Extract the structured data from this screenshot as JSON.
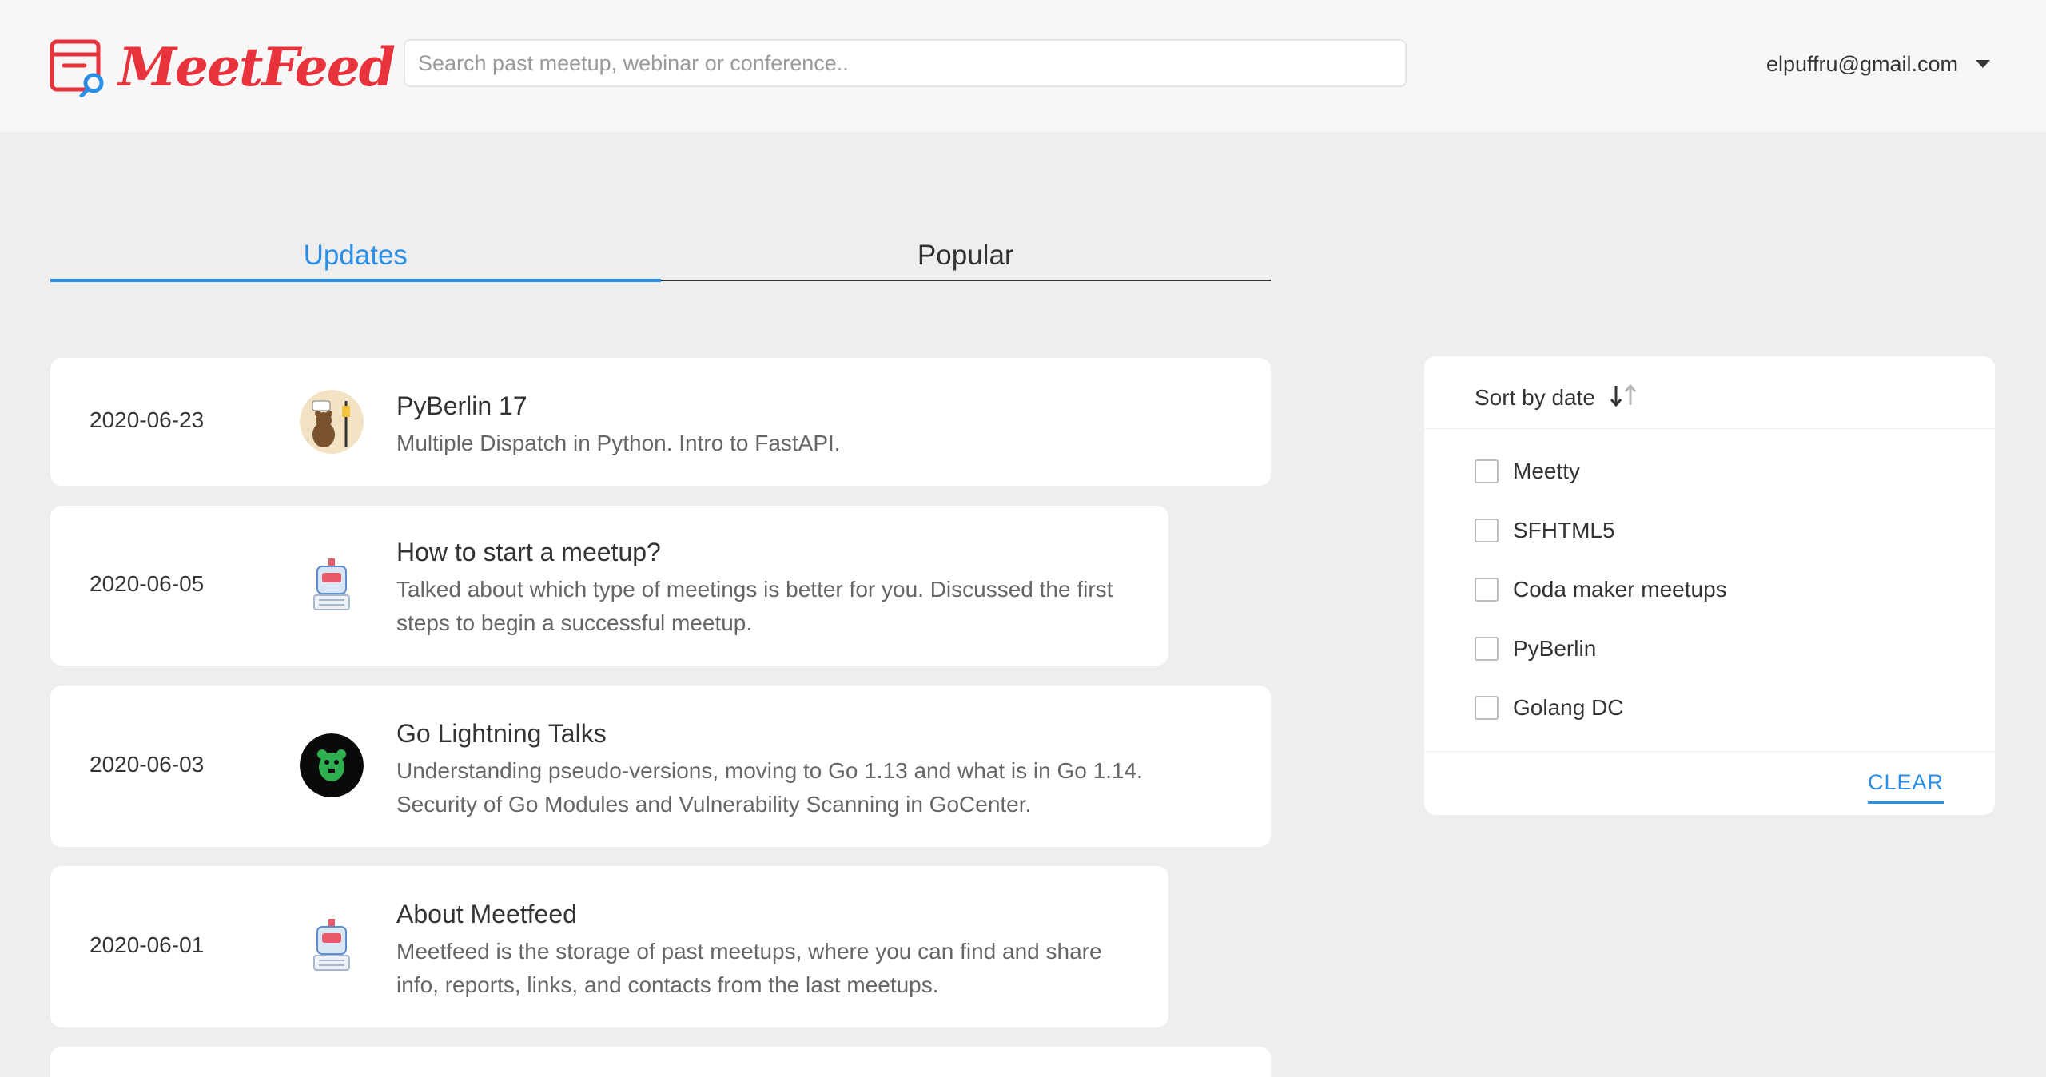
{
  "header": {
    "logo_text": "MeetFeed",
    "search_placeholder": "Search past meetup, webinar or conference..",
    "user_email": "elpuffru@gmail.com"
  },
  "tabs": [
    {
      "label": "Updates",
      "active": true
    },
    {
      "label": "Popular",
      "active": false
    }
  ],
  "feed": [
    {
      "date": "2020-06-23",
      "title": "PyBerlin 17",
      "desc": "Multiple Dispatch in Python. Intro to FastAPI.",
      "avatar": "pyberlin-bear-icon"
    },
    {
      "date": "2020-06-05",
      "title": "How to start a meetup?",
      "desc": "Talked about which type of meetings is better for you. Discussed the first steps to begin a successful meetup.",
      "avatar": "meetty-robot-icon"
    },
    {
      "date": "2020-06-03",
      "title": "Go Lightning Talks",
      "desc": "Understanding pseudo-versions, moving to Go 1.13 and what is in Go 1.14. Security of Go Modules and Vulnerability Scanning in GoCenter.",
      "avatar": "golang-gopher-icon"
    },
    {
      "date": "2020-06-01",
      "title": "About Meetfeed",
      "desc": "Meetfeed is the storage of past meetups, where you can find and share info, reports, links, and contacts from the last meetups.",
      "avatar": "meetty-robot-icon"
    }
  ],
  "sidebar": {
    "sort_label": "Sort by date",
    "filters": [
      {
        "label": "Meetty",
        "checked": false
      },
      {
        "label": "SFHTML5",
        "checked": false
      },
      {
        "label": "Coda maker meetups",
        "checked": false
      },
      {
        "label": "PyBerlin",
        "checked": false
      },
      {
        "label": "Golang DC",
        "checked": false
      }
    ],
    "clear_label": "CLEAR"
  },
  "colors": {
    "brand": "#e8323c",
    "accent": "#2b8fe6",
    "page_bg": "#eeeeee",
    "header_bg": "#f7f7f7"
  }
}
